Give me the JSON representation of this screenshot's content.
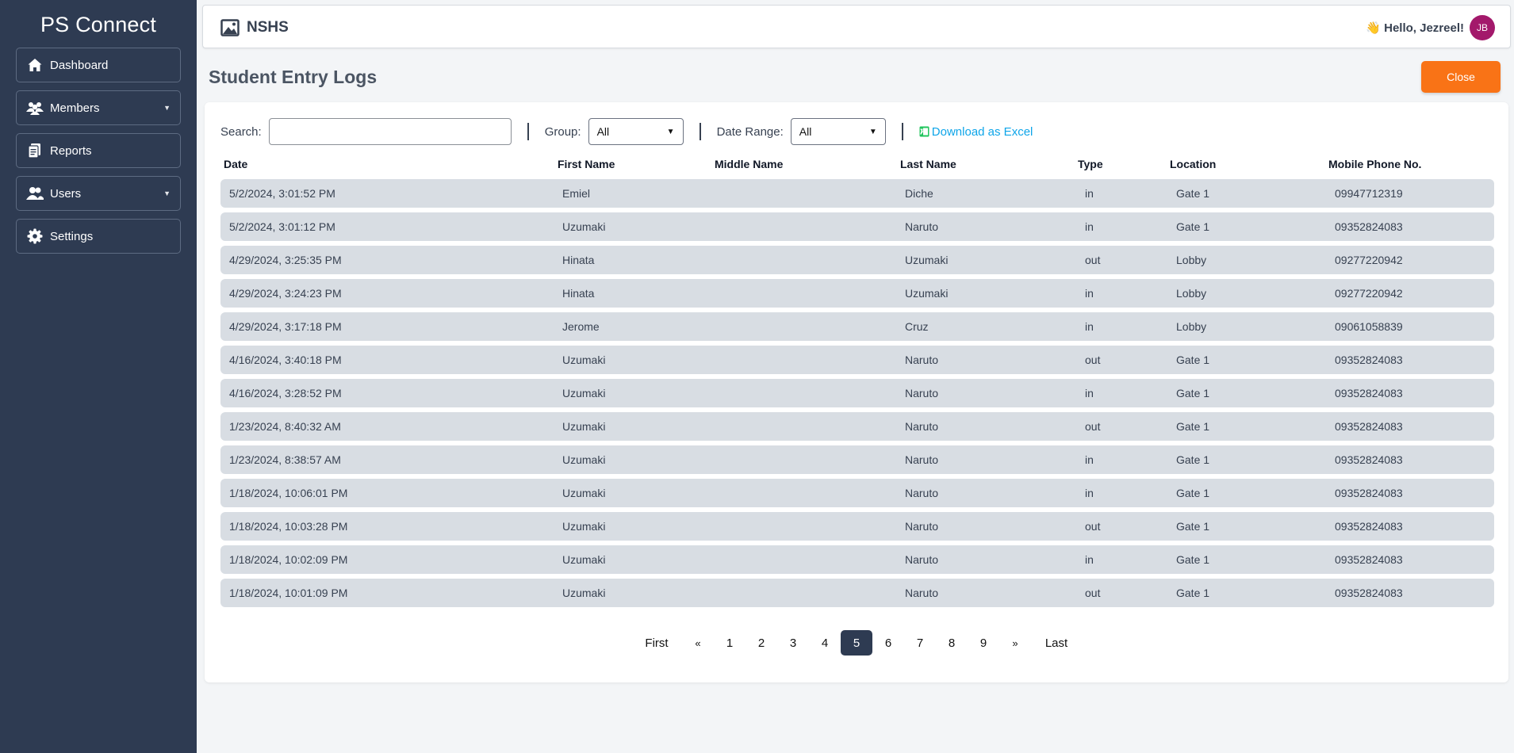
{
  "sidebar": {
    "brand": "PS Connect",
    "items": [
      {
        "label": "Dashboard",
        "icon": "home-icon",
        "caret": false
      },
      {
        "label": "Members",
        "icon": "members-icon",
        "caret": true
      },
      {
        "label": "Reports",
        "icon": "reports-icon",
        "caret": false
      },
      {
        "label": "Users",
        "icon": "users-icon",
        "caret": true
      },
      {
        "label": "Settings",
        "icon": "gear-icon",
        "caret": false
      }
    ]
  },
  "header": {
    "org": "NSHS",
    "greeting": "👋 Hello, Jezreel!",
    "avatar_initials": "JB",
    "avatar_color": "#a3196b"
  },
  "page": {
    "title": "Student Entry Logs",
    "close_label": "Close"
  },
  "filters": {
    "search_label": "Search:",
    "search_value": "",
    "group_label": "Group:",
    "group_value": "All",
    "date_range_label": "Date Range:",
    "date_range_value": "All",
    "download_label": "Download as Excel"
  },
  "table": {
    "columns": [
      "Date",
      "First Name",
      "Middle Name",
      "Last Name",
      "Type",
      "Location",
      "Mobile Phone No."
    ],
    "rows": [
      [
        "5/2/2024, 3:01:52 PM",
        "Emiel",
        "",
        "Diche",
        "in",
        "Gate 1",
        "09947712319"
      ],
      [
        "5/2/2024, 3:01:12 PM",
        "Uzumaki",
        "",
        "Naruto",
        "in",
        "Gate 1",
        "09352824083"
      ],
      [
        "4/29/2024, 3:25:35 PM",
        "Hinata",
        "",
        "Uzumaki",
        "out",
        "Lobby",
        "09277220942"
      ],
      [
        "4/29/2024, 3:24:23 PM",
        "Hinata",
        "",
        "Uzumaki",
        "in",
        "Lobby",
        "09277220942"
      ],
      [
        "4/29/2024, 3:17:18 PM",
        "Jerome",
        "",
        "Cruz",
        "in",
        "Lobby",
        "09061058839"
      ],
      [
        "4/16/2024, 3:40:18 PM",
        "Uzumaki",
        "",
        "Naruto",
        "out",
        "Gate 1",
        "09352824083"
      ],
      [
        "4/16/2024, 3:28:52 PM",
        "Uzumaki",
        "",
        "Naruto",
        "in",
        "Gate 1",
        "09352824083"
      ],
      [
        "1/23/2024, 8:40:32 AM",
        "Uzumaki",
        "",
        "Naruto",
        "out",
        "Gate 1",
        "09352824083"
      ],
      [
        "1/23/2024, 8:38:57 AM",
        "Uzumaki",
        "",
        "Naruto",
        "in",
        "Gate 1",
        "09352824083"
      ],
      [
        "1/18/2024, 10:06:01 PM",
        "Uzumaki",
        "",
        "Naruto",
        "in",
        "Gate 1",
        "09352824083"
      ],
      [
        "1/18/2024, 10:03:28 PM",
        "Uzumaki",
        "",
        "Naruto",
        "out",
        "Gate 1",
        "09352824083"
      ],
      [
        "1/18/2024, 10:02:09 PM",
        "Uzumaki",
        "",
        "Naruto",
        "in",
        "Gate 1",
        "09352824083"
      ],
      [
        "1/18/2024, 10:01:09 PM",
        "Uzumaki",
        "",
        "Naruto",
        "out",
        "Gate 1",
        "09352824083"
      ]
    ]
  },
  "pagination": {
    "items": [
      "First",
      "«",
      "1",
      "2",
      "3",
      "4",
      "5",
      "6",
      "7",
      "8",
      "9",
      "»",
      "Last"
    ],
    "active": "5"
  },
  "colors": {
    "sidebar_bg": "#2e3b52",
    "accent_orange": "#f97316",
    "link_blue": "#0ea5e9",
    "row_bg": "#d8dde3"
  }
}
